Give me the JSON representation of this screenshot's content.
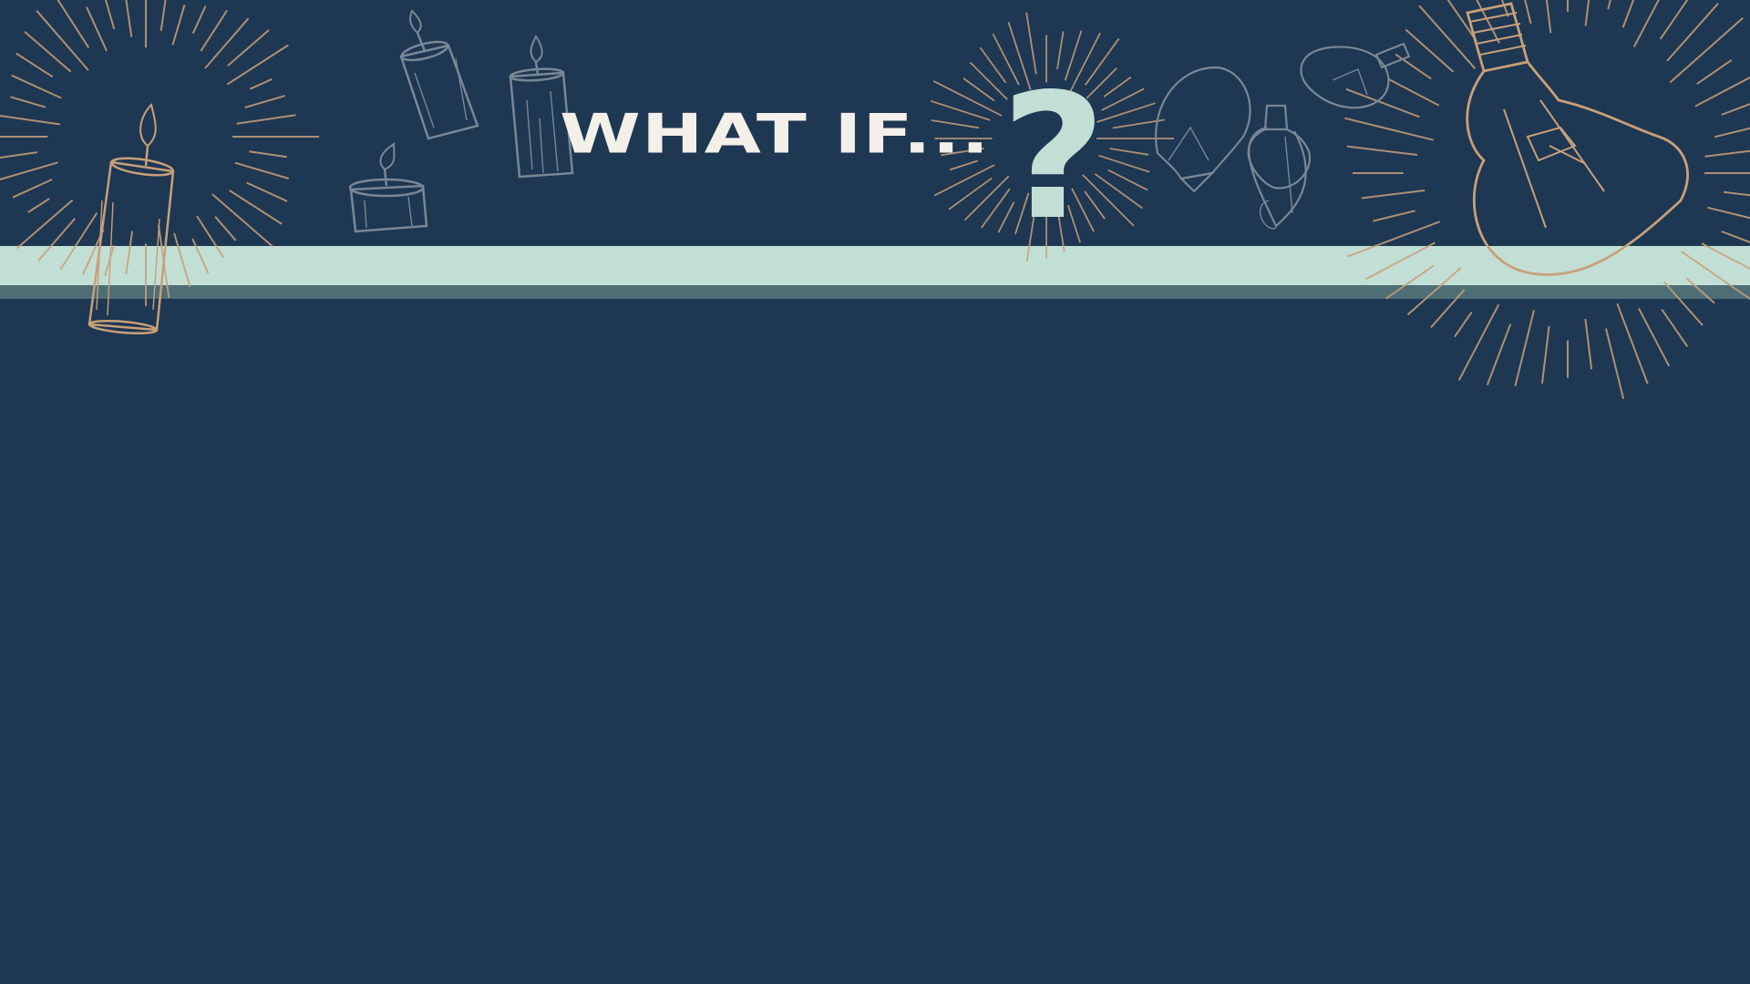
{
  "slide": {
    "title": "WHAT IF...",
    "question_mark": "?"
  },
  "colors": {
    "background": "#1e3752",
    "band": "#c2dfd6",
    "band_shadow": "#4e6e76",
    "title_text": "#f3efe9",
    "accent": "#c2dfd6",
    "illustration_gold": "#c8a07a",
    "illustration_grey": "#7a8795"
  },
  "illustrations": [
    {
      "icon": "glowing-candle-icon"
    },
    {
      "icon": "candle-icon"
    },
    {
      "icon": "candle-icon"
    },
    {
      "icon": "tealight-candle-icon"
    },
    {
      "icon": "light-bulb-icon"
    },
    {
      "icon": "light-bulb-icon"
    },
    {
      "icon": "light-bulb-icon"
    },
    {
      "icon": "glowing-light-bulb-icon"
    }
  ]
}
